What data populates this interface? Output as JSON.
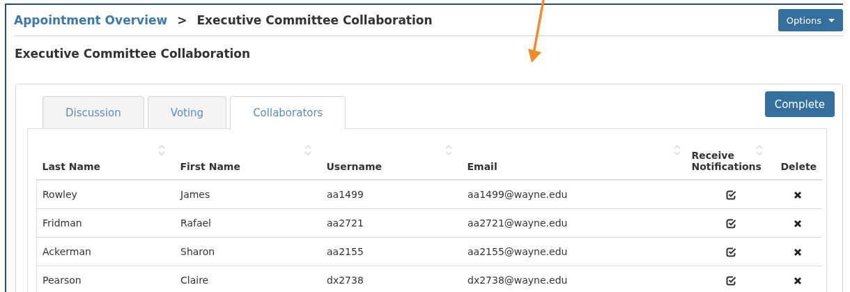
{
  "breadcrumb": {
    "link": "Appointment Overview",
    "separator": ">",
    "current": "Executive Committee Collaboration"
  },
  "options_button": "Options",
  "title": "Executive Committee Collaboration",
  "complete_button": "Complete",
  "tabs": [
    {
      "label": "Discussion",
      "selected": false
    },
    {
      "label": "Voting",
      "selected": false
    },
    {
      "label": "Collaborators",
      "selected": true
    }
  ],
  "table": {
    "columns": [
      {
        "label": "Last Name",
        "sortable": true
      },
      {
        "label": "First Name",
        "sortable": true
      },
      {
        "label": "Username",
        "sortable": true
      },
      {
        "label": "Email",
        "sortable": true
      },
      {
        "label": "Receive Notifications",
        "sortable": true
      },
      {
        "label": "Delete",
        "sortable": false
      }
    ],
    "rows": [
      {
        "last_name": "Rowley",
        "first_name": "James",
        "username": "aa1499",
        "email": "aa1499@wayne.edu",
        "notifications": true
      },
      {
        "last_name": "Fridman",
        "first_name": "Rafael",
        "username": "aa2721",
        "email": "aa2721@wayne.edu",
        "notifications": true
      },
      {
        "last_name": "Ackerman",
        "first_name": "Sharon",
        "username": "aa2155",
        "email": "aa2155@wayne.edu",
        "notifications": true
      },
      {
        "last_name": "Pearson",
        "first_name": "Claire",
        "username": "dx2738",
        "email": "dx2738@wayne.edu",
        "notifications": true
      }
    ]
  }
}
